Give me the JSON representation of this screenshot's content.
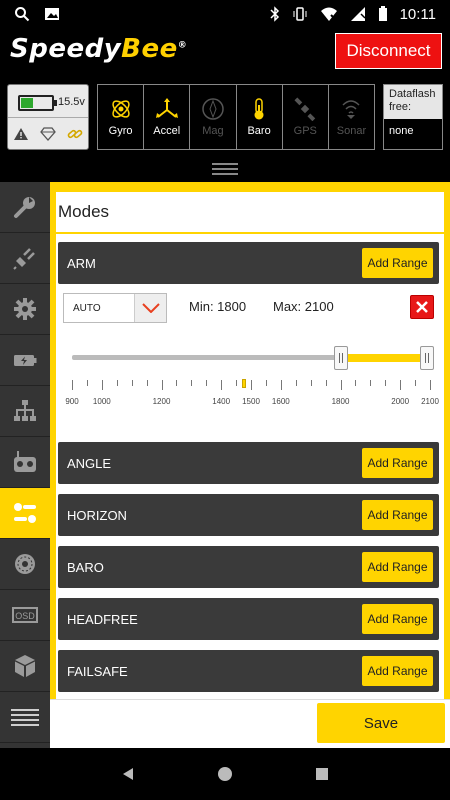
{
  "status_bar": {
    "time": "10:11"
  },
  "app": {
    "logo_main": "Speedy",
    "logo_accent": "Bee",
    "logo_mark": "®",
    "disconnect_label": "Disconnect"
  },
  "battery": {
    "voltage": "15.5v",
    "level": 0.4
  },
  "sensors": [
    {
      "label": "Gyro",
      "icon": "gyro-icon",
      "active": true
    },
    {
      "label": "Accel",
      "icon": "accel-icon",
      "active": true
    },
    {
      "label": "Mag",
      "icon": "compass-icon",
      "active": false
    },
    {
      "label": "Baro",
      "icon": "thermometer-icon",
      "active": true
    },
    {
      "label": "GPS",
      "icon": "satellite-icon",
      "active": false
    },
    {
      "label": "Sonar",
      "icon": "sonar-icon",
      "active": false
    }
  ],
  "dataflash": {
    "label": "Dataflash free:",
    "value": "none"
  },
  "sidebar": {
    "items": [
      {
        "name": "wrench",
        "icon": "wrench-icon",
        "active": false
      },
      {
        "name": "power",
        "icon": "plug-icon",
        "active": false
      },
      {
        "name": "configuration",
        "icon": "gear-icon",
        "active": false
      },
      {
        "name": "battery",
        "icon": "battery-icon",
        "active": false
      },
      {
        "name": "receiver",
        "icon": "network-icon",
        "active": false
      },
      {
        "name": "transmitter",
        "icon": "controller-icon",
        "active": false
      },
      {
        "name": "modes",
        "icon": "toggles-icon",
        "active": true
      },
      {
        "name": "motors",
        "icon": "motor-icon",
        "active": false
      },
      {
        "name": "osd",
        "icon": "osd-icon",
        "active": false
      },
      {
        "name": "blackbox",
        "icon": "cube-icon",
        "active": false
      },
      {
        "name": "menu",
        "icon": "menu-icon",
        "active": false
      }
    ]
  },
  "modes": {
    "title": "Modes",
    "add_range_label": "Add Range",
    "rows": [
      {
        "name": "ARM"
      },
      {
        "name": "ANGLE"
      },
      {
        "name": "HORIZON"
      },
      {
        "name": "BARO"
      },
      {
        "name": "HEADFREE"
      },
      {
        "name": "FAILSAFE"
      }
    ],
    "range": {
      "channel": "AUTO",
      "min_label": "Min: 1800",
      "max_label": "Max: 2100",
      "min": 1800,
      "max": 2100,
      "scale_min": 900,
      "scale_max": 2100,
      "current": 1475,
      "tick_labels": [
        "900",
        "1000",
        "1200",
        "1400",
        "1500",
        "1600",
        "1800",
        "2000",
        "2100"
      ],
      "tick_values": [
        900,
        1000,
        1200,
        1400,
        1500,
        1600,
        1800,
        2000,
        2100
      ]
    }
  },
  "save_label": "Save",
  "colors": {
    "accent": "#ffd400",
    "danger": "#ee1111",
    "row": "#3a3a3a",
    "sidebar": "#343434"
  }
}
